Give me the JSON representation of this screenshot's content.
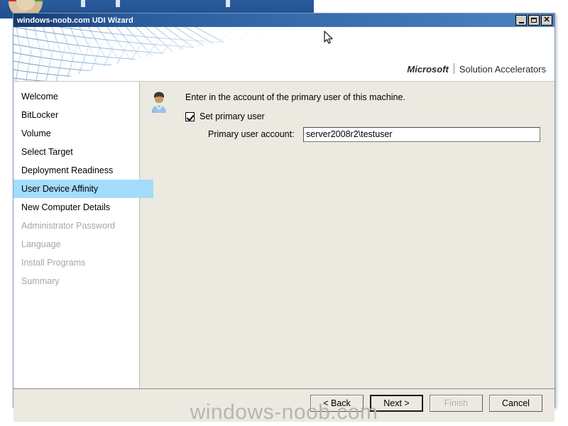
{
  "window": {
    "title": "windows-noob.com UDI Wizard",
    "controls": {
      "minimize": "minimize-icon",
      "maximize": "maximize-icon",
      "close": "✕"
    }
  },
  "banner": {
    "brand_microsoft": "Microsoft",
    "brand_product": "Solution Accelerators",
    "graphic": "mesh-lattice-graphic"
  },
  "sidebar": {
    "items": [
      {
        "label": "Welcome",
        "state": "normal"
      },
      {
        "label": "BitLocker",
        "state": "normal"
      },
      {
        "label": "Volume",
        "state": "normal"
      },
      {
        "label": "Select Target",
        "state": "normal"
      },
      {
        "label": "Deployment Readiness",
        "state": "normal"
      },
      {
        "label": "User Device Affinity",
        "state": "active"
      },
      {
        "label": "New Computer Details",
        "state": "normal"
      },
      {
        "label": "Administrator Password",
        "state": "disabled"
      },
      {
        "label": "Language",
        "state": "disabled"
      },
      {
        "label": "Install Programs",
        "state": "disabled"
      },
      {
        "label": "Summary",
        "state": "disabled"
      }
    ],
    "active_label": "User Device Affinity"
  },
  "content": {
    "icon": "user-avatar-icon",
    "instruction": "Enter in the account of the primary user of this machine.",
    "checkbox": {
      "label": "Set primary user",
      "checked": true
    },
    "field": {
      "label": "Primary user account:",
      "value": "server2008r2\\testuser",
      "placeholder": ""
    }
  },
  "footer": {
    "back_label": "< Back",
    "next_label": "Next >",
    "finish_label": "Finish",
    "cancel_label": "Cancel",
    "finish_disabled": true,
    "next_focused": true
  },
  "watermark": {
    "text": "windows-noob.com"
  },
  "colors": {
    "titlebar_dark": "#173a70",
    "titlebar_light": "#4c83bf",
    "sidebar_highlight": "#a5dcfc",
    "content_bg": "#ece9e0",
    "disabled_text": "#a6a6a6",
    "desktop_bg": "#1f4f8f"
  }
}
